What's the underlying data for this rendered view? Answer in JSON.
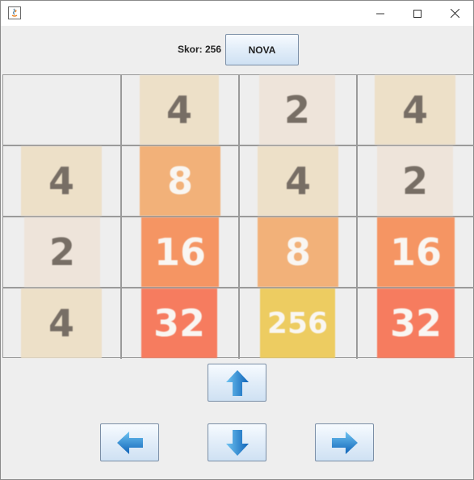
{
  "score": {
    "label": "Skor: 256"
  },
  "buttons": {
    "new_game": "NOVA"
  },
  "board": {
    "rows": [
      [
        "",
        "4",
        "2",
        "4"
      ],
      [
        "4",
        "8",
        "4",
        "2"
      ],
      [
        "2",
        "16",
        "8",
        "16"
      ],
      [
        "4",
        "32",
        "256",
        "32"
      ]
    ]
  },
  "tile_colors": {
    "2": {
      "bg": "#eee4da",
      "fg": "#776e65"
    },
    "4": {
      "bg": "#ede0c8",
      "fg": "#776e65"
    },
    "8": {
      "bg": "#f2b179",
      "fg": "#f9f6f2"
    },
    "16": {
      "bg": "#f59563",
      "fg": "#f9f6f2"
    },
    "32": {
      "bg": "#f67c5f",
      "fg": "#f9f6f2"
    },
    "256": {
      "bg": "#edcc61",
      "fg": "#f9f6f2"
    }
  },
  "controls": [
    "arrow-up-icon",
    "arrow-left-icon",
    "arrow-down-icon",
    "arrow-right-icon"
  ]
}
